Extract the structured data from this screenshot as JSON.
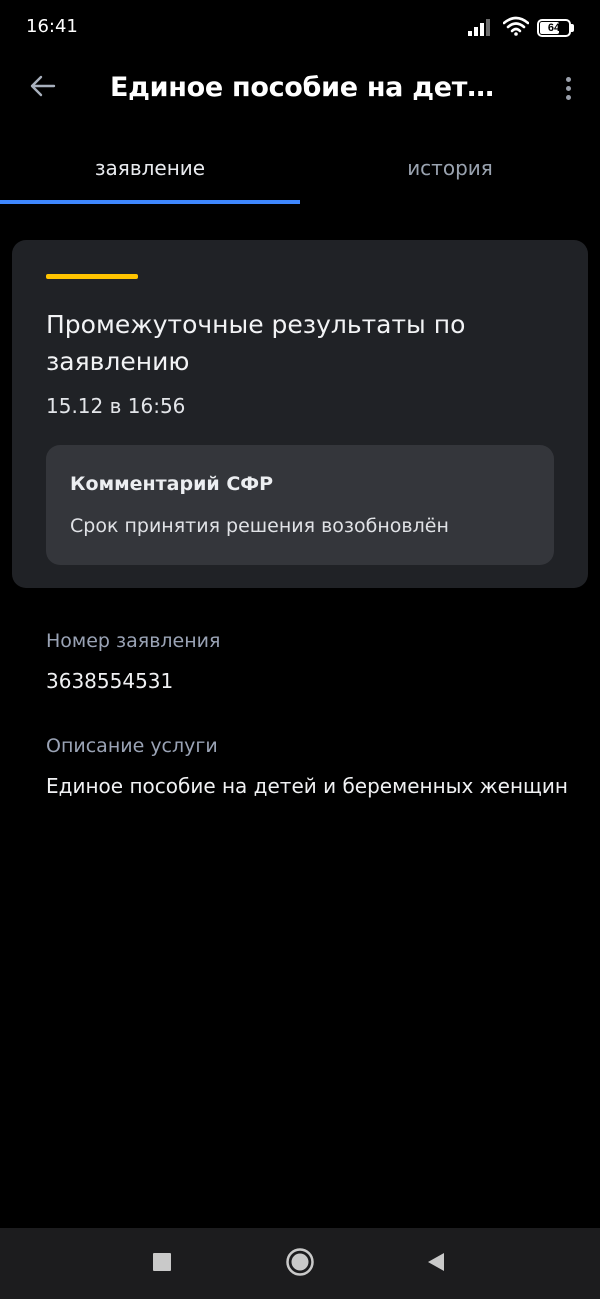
{
  "status_bar": {
    "time": "16:41",
    "battery_level": "64",
    "icons": [
      "signal-icon",
      "wifi-icon",
      "battery-icon"
    ]
  },
  "app_bar": {
    "title": "Единое пособие на детей и беременных женщин",
    "back_icon": "arrow-left-icon",
    "menu_icon": "more-vertical-icon"
  },
  "tabs": [
    {
      "label": "заявление",
      "active": true
    },
    {
      "label": "история",
      "active": false
    }
  ],
  "status_card": {
    "accent_color": "#ffc400",
    "title": "Промежуточные результаты по заявлению",
    "date": "15.12 в 16:56",
    "comment": {
      "title": "Комментарий СФР",
      "text": "Срок принятия решения возобновлён"
    }
  },
  "fields": {
    "application_number": {
      "label": "Номер заявления",
      "value": "3638554531"
    },
    "service_description": {
      "label": "Описание услуги",
      "value": "Единое пособие на детей и беременных женщин"
    }
  },
  "nav_bar": {
    "icons": [
      "square-icon",
      "home-circle-icon",
      "back-triangle-icon"
    ]
  },
  "colors": {
    "background": "#000000",
    "card": "#202226",
    "comment_box": "#34363b",
    "tab_indicator": "#3f88ff",
    "accent": "#ffc400"
  }
}
